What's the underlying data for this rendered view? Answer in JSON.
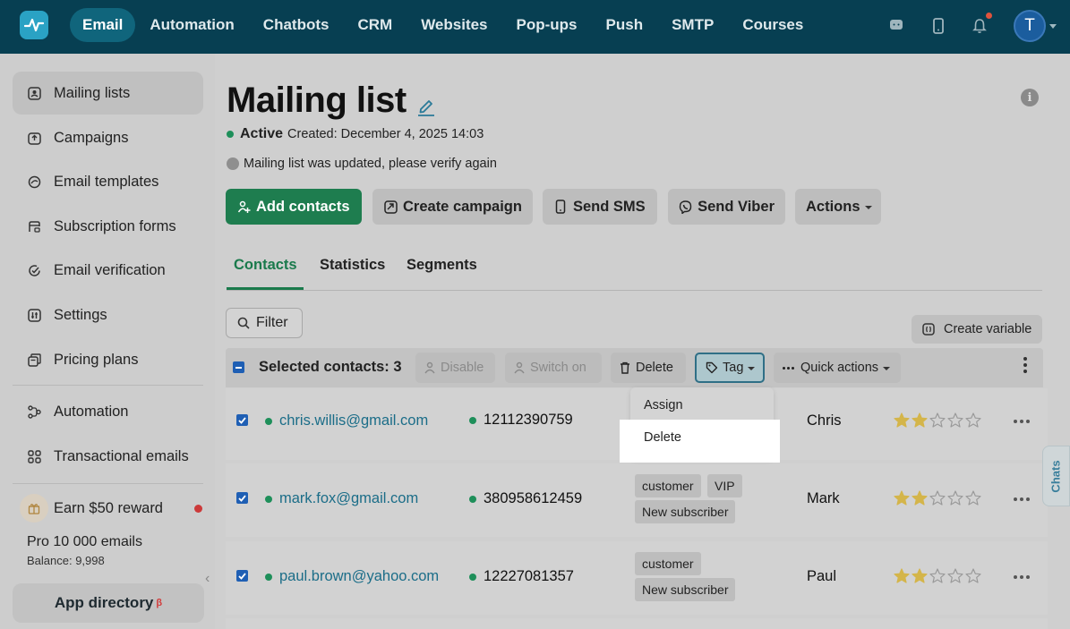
{
  "nav": {
    "items": [
      "Email",
      "Automation",
      "Chatbots",
      "CRM",
      "Websites",
      "Pop-ups",
      "Push",
      "SMTP",
      "Courses"
    ],
    "active": "Email",
    "avatar_letter": "T"
  },
  "sidebar": {
    "items": [
      {
        "label": "Mailing lists",
        "icon": "contacts-icon"
      },
      {
        "label": "Campaigns",
        "icon": "campaign-icon"
      },
      {
        "label": "Email templates",
        "icon": "template-icon"
      },
      {
        "label": "Subscription forms",
        "icon": "form-icon"
      },
      {
        "label": "Email verification",
        "icon": "verify-icon"
      },
      {
        "label": "Settings",
        "icon": "settings-icon"
      },
      {
        "label": "Pricing plans",
        "icon": "pricing-icon"
      }
    ],
    "items2": [
      {
        "label": "Automation",
        "icon": "automation-icon"
      },
      {
        "label": "Transactional emails",
        "icon": "grid-icon"
      }
    ],
    "reward": "Earn $50 reward",
    "plan": "Pro 10 000 emails",
    "balance": "Balance: 9,998",
    "app_directory": "App directory",
    "app_directory_badge": "β"
  },
  "page": {
    "title": "Mailing list",
    "status": "Active",
    "created": "Created: December 4, 2025 14:03",
    "updated_notice": "Mailing list was updated, please verify again"
  },
  "actions": {
    "add_contacts": "Add contacts",
    "create_campaign": "Create campaign",
    "send_sms": "Send SMS",
    "send_viber": "Send Viber",
    "actions": "Actions"
  },
  "tabs": [
    "Contacts",
    "Statistics",
    "Segments"
  ],
  "toolbar": {
    "filter": "Filter",
    "create_variable": "Create variable",
    "selected": "Selected contacts: 3",
    "disable": "Disable",
    "switch_on": "Switch on",
    "delete": "Delete",
    "tag": "Tag",
    "quick_actions": "Quick actions"
  },
  "tag_menu": {
    "assign": "Assign",
    "delete": "Delete"
  },
  "contacts": [
    {
      "email": "chris.willis@gmail.com",
      "phone": "12112390759",
      "tags": [],
      "name": "Chris",
      "rating": 2
    },
    {
      "email": "mark.fox@gmail.com",
      "phone": "380958612459",
      "tags": [
        "customer",
        "VIP",
        "New subscriber"
      ],
      "name": "Mark",
      "rating": 2
    },
    {
      "email": "paul.brown@yahoo.com",
      "phone": "12227081357",
      "tags": [
        "customer",
        "New subscriber"
      ],
      "name": "Paul",
      "rating": 2
    }
  ],
  "chats_label": "Chats",
  "colors": {
    "brand": "#073f52",
    "primary": "#1e7d4f",
    "link": "#1b6d88",
    "star": "#d4b54a"
  }
}
